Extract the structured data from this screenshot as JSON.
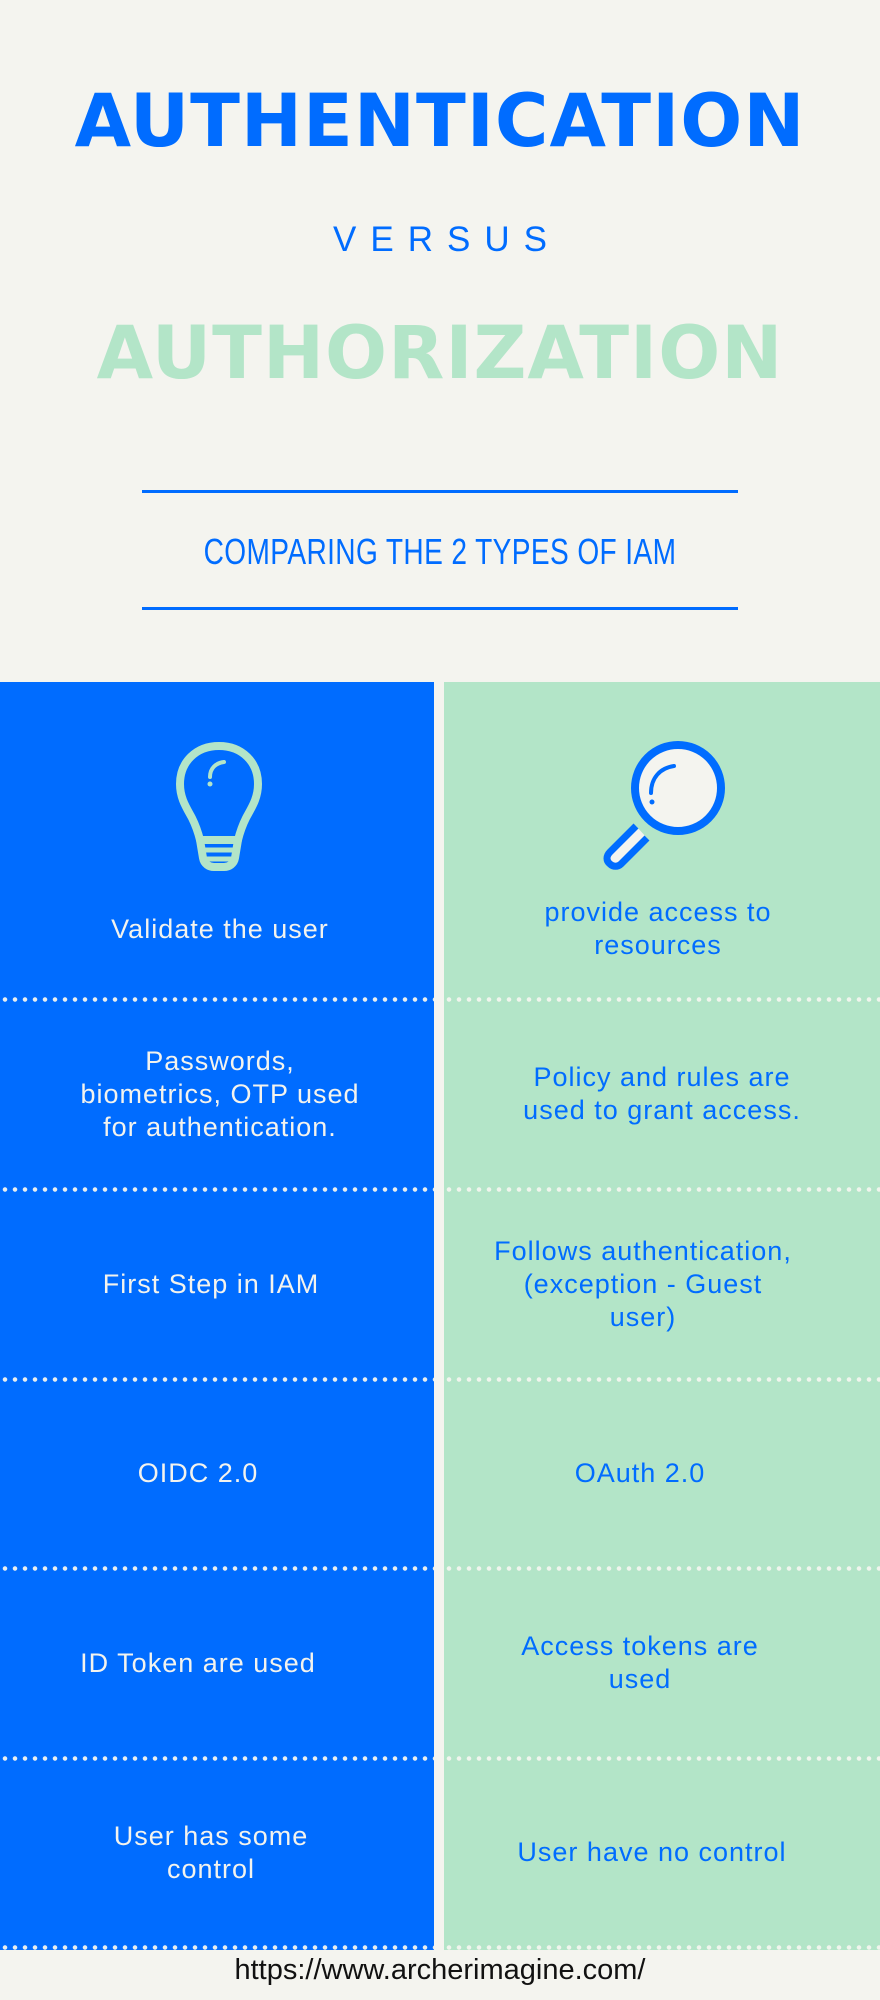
{
  "header": {
    "title_primary": "AUTHENTICATION",
    "versus": "VERSUS",
    "title_secondary": "AUTHORIZATION",
    "subtitle": "COMPARING THE 2 TYPES OF IAM"
  },
  "colors": {
    "primary_blue": "#006CFF",
    "mint_green": "#B3E5C8",
    "background": "#F4F4EF",
    "light_text": "#F3F3EE",
    "footer_text": "#111111"
  },
  "columns": {
    "left": {
      "topic": "Authentication",
      "icon": "lightbulb-icon"
    },
    "right": {
      "topic": "Authorization",
      "icon": "magnifying-glass-icon"
    }
  },
  "rows": [
    {
      "left": [
        "Validate the user"
      ],
      "right": [
        "provide access to",
        "resources"
      ]
    },
    {
      "left": [
        "Passwords,",
        "biometrics, OTP used",
        "for authentication."
      ],
      "right": [
        "Policy and rules are",
        "used to grant access."
      ]
    },
    {
      "left": [
        "First Step in IAM"
      ],
      "right": [
        "Follows authentication,",
        "(exception - Guest",
        "user)"
      ]
    },
    {
      "left": [
        "OIDC 2.0"
      ],
      "right": [
        "OAuth 2.0"
      ]
    },
    {
      "left": [
        "ID Token are used"
      ],
      "right": [
        "Access tokens are",
        "used"
      ]
    },
    {
      "left": [
        "User has some",
        "control"
      ],
      "right": [
        "User have no control"
      ]
    }
  ],
  "footer": {
    "url": "https://www.archerimagine.com/"
  }
}
